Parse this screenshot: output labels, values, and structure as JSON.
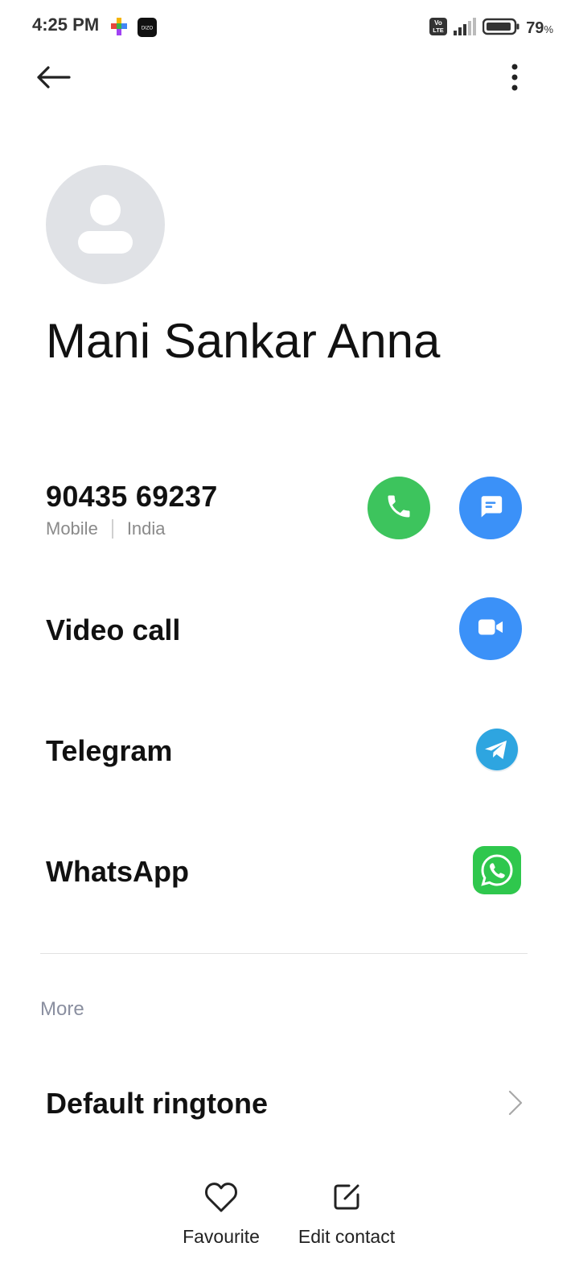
{
  "status_bar": {
    "time": "4:25 PM",
    "battery_value": "79",
    "battery_unit": "%",
    "icons": [
      "app-colorful-icon",
      "dizo-app-icon",
      "volte-icon",
      "signal-icon",
      "battery-icon"
    ],
    "dizo_label": "DIZO",
    "volte_label_top": "Vo",
    "volte_label_bottom": "LTE"
  },
  "top_bar": {
    "back_icon": "arrow-left-icon",
    "menu_icon": "more-vertical-icon"
  },
  "contact": {
    "name": "Mani Sankar Anna",
    "avatar_icon": "person-icon"
  },
  "phone": {
    "number": "90435 69237",
    "type": "Mobile",
    "region": "India",
    "call_icon": "phone-icon",
    "message_icon": "message-icon"
  },
  "actions": {
    "video_call": "Video call",
    "telegram": "Telegram",
    "whatsapp": "WhatsApp"
  },
  "more_section": {
    "header": "More",
    "default_ringtone": "Default ringtone"
  },
  "bottom_bar": {
    "favourite": "Favourite",
    "edit_contact": "Edit contact"
  },
  "colors": {
    "call_green": "#3dc45d",
    "action_blue": "#3b91f8",
    "telegram_blue": "#2ea5e0",
    "whatsapp_green": "#2fc74d",
    "avatar_bg": "#e0e2e6",
    "secondary_text": "#8a8a8a"
  }
}
